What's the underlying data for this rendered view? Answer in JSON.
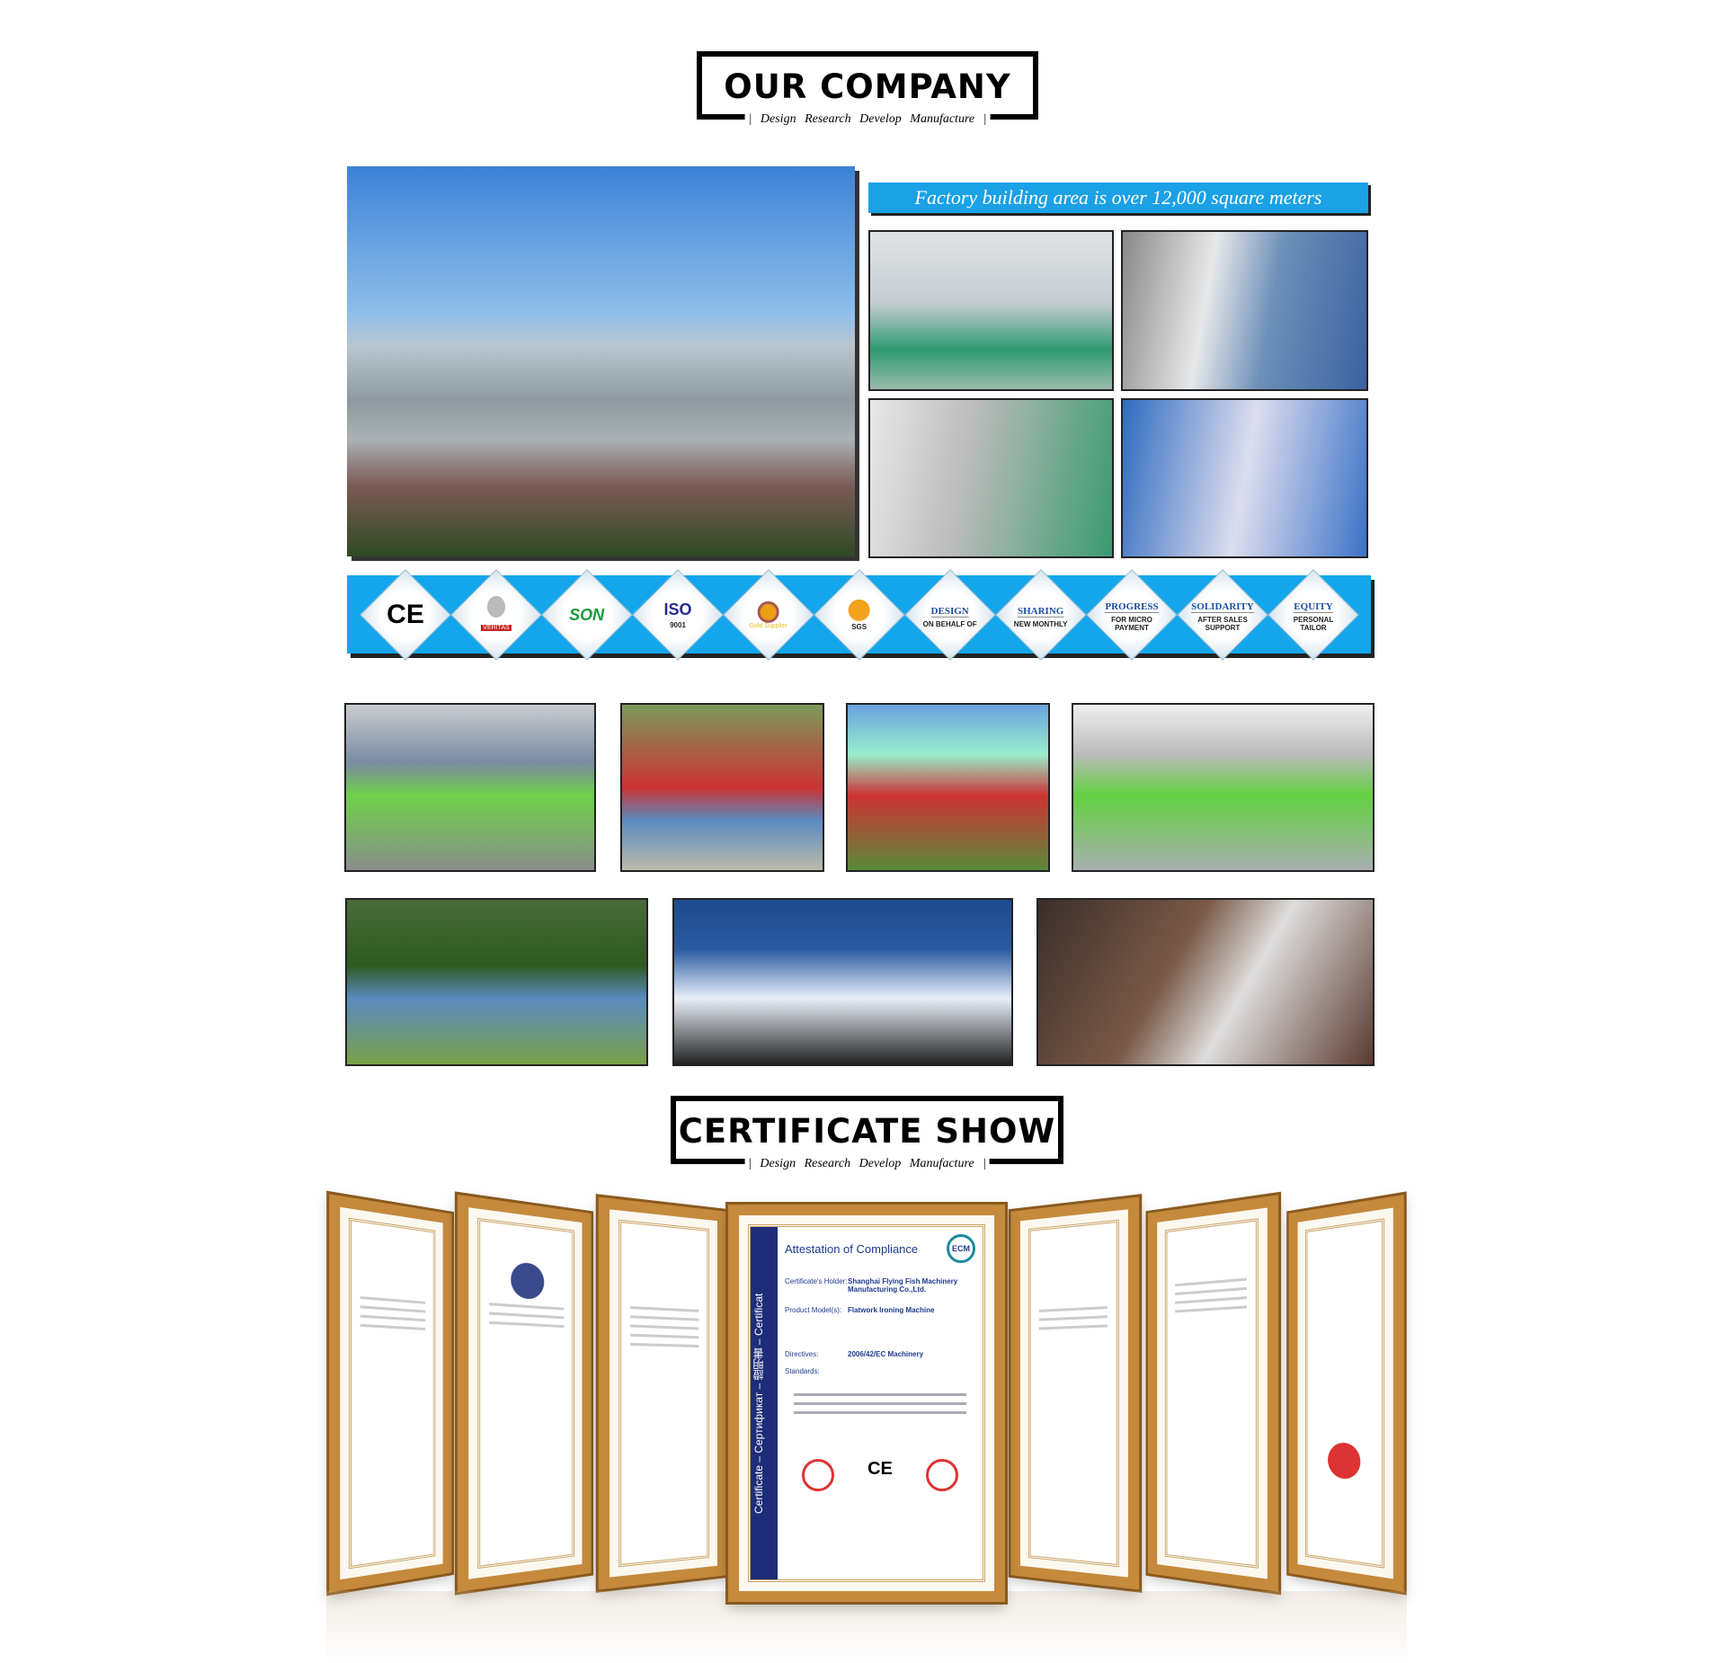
{
  "company_header": {
    "title": "OUR COMPANY",
    "subtitle": "| Design  Research  Develop  Manufacture |"
  },
  "factory": {
    "caption": "Factory building area is over 12,000 square meters"
  },
  "badges": [
    {
      "icon": "ce-mark-icon",
      "title": "CE",
      "sub": ""
    },
    {
      "icon": "bureau-veritas-icon",
      "title": "",
      "sub": "VERITAS"
    },
    {
      "icon": "son-icon",
      "title": "SON",
      "sub": ""
    },
    {
      "icon": "iso-icon",
      "title": "ISO",
      "sub": "9001"
    },
    {
      "icon": "gold-supplier-icon",
      "title": "",
      "sub": "Gold Supplier"
    },
    {
      "icon": "sgs-icon",
      "title": "",
      "sub": "SGS"
    },
    {
      "icon": "",
      "title": "DESIGN",
      "sub": "ON BEHALF OF"
    },
    {
      "icon": "",
      "title": "SHARING",
      "sub": "NEW MONTHLY"
    },
    {
      "icon": "",
      "title": "PROGRESS",
      "sub": "FOR MICRO PAYMENT"
    },
    {
      "icon": "",
      "title": "SOLIDARITY",
      "sub": "AFTER SALES SUPPORT"
    },
    {
      "icon": "",
      "title": "EQUITY",
      "sub": "PERSONAL TAILOR"
    }
  ],
  "certificate_header": {
    "title": "CERTIFICATE SHOW",
    "subtitle": "| Design  Research  Develop  Manufacture |"
  },
  "certificate": {
    "title": "Attestation of Compliance",
    "badge": "ECM",
    "holder_label": "Certificate's Holder:",
    "holder": "Shanghai Flying Fish Machinery Manufacturing Co.,Ltd.",
    "product_label": "Product Model(s):",
    "product": "Flatwork Ironing Machine",
    "directives_label": "Directives:",
    "directives": "2006/42/EC Machinery",
    "standards_label": "Standards:",
    "side_text": "Certificate – Сертификат – 證明書 – Certificat"
  },
  "colors": {
    "accent": "#13a6ec",
    "frame": "#c58a3c"
  }
}
